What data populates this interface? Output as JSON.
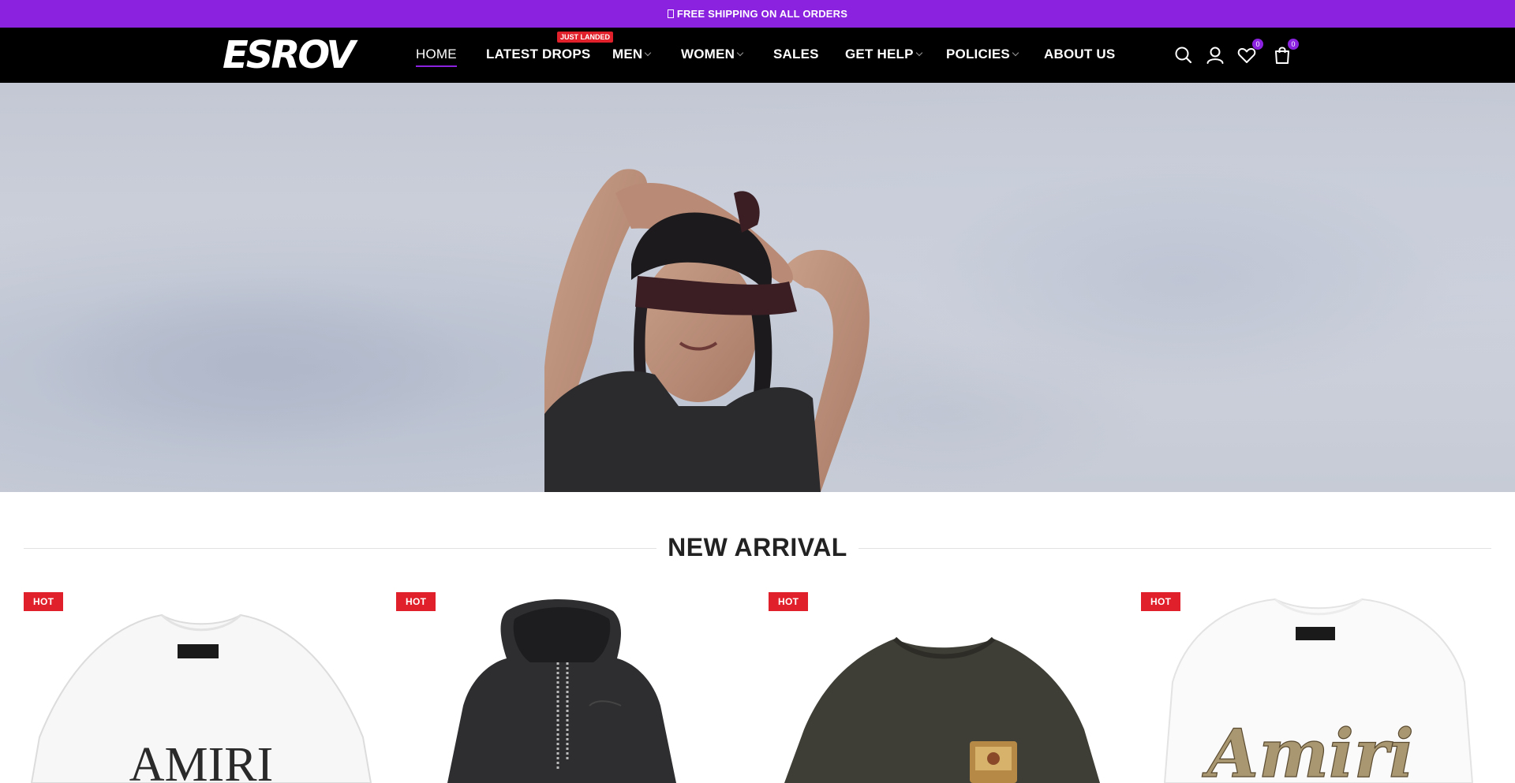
{
  "announcement": {
    "text": "FREE SHIPPING ON ALL ORDERS"
  },
  "brand": {
    "logo_text": "ESROV"
  },
  "nav": {
    "items": [
      {
        "label": "HOME",
        "active": true,
        "has_dropdown": false
      },
      {
        "label": "LATEST DROPS",
        "active": false,
        "has_dropdown": false
      },
      {
        "label": "MEN",
        "active": false,
        "has_dropdown": true
      },
      {
        "label": "WOMEN",
        "active": false,
        "has_dropdown": true
      },
      {
        "label": "SALES",
        "active": false,
        "has_dropdown": false
      },
      {
        "label": "GET HELP",
        "active": false,
        "has_dropdown": true
      },
      {
        "label": "POLICIES",
        "active": false,
        "has_dropdown": true
      },
      {
        "label": "ABOUT US",
        "active": false,
        "has_dropdown": false
      }
    ],
    "latest_drops_badge": "JUST LANDED"
  },
  "header_icons": {
    "search": "search-icon",
    "account": "user-icon",
    "wishlist": {
      "icon": "heart-icon",
      "count": "0"
    },
    "cart": {
      "icon": "shopping-bag-icon",
      "count": "0"
    }
  },
  "section": {
    "title": "NEW ARRIVAL"
  },
  "products": [
    {
      "badge": "HOT",
      "image": "white-tshirt-amiri-print",
      "print_text": "AMIRI"
    },
    {
      "badge": "HOT",
      "image": "black-hoodie"
    },
    {
      "badge": "HOT",
      "image": "olive-faded-tshirt"
    },
    {
      "badge": "HOT",
      "image": "white-tshirt-amiri-script",
      "print_text": "Amiri"
    }
  ],
  "colors": {
    "accent": "#8a22e0",
    "badge": "#e0202a",
    "header_bg": "#000000"
  }
}
